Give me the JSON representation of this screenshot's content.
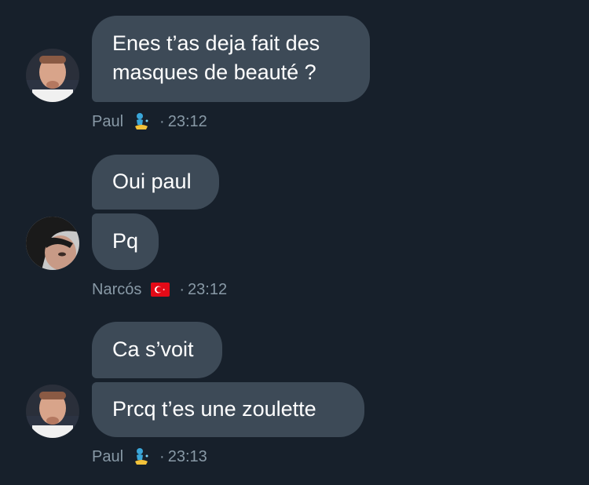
{
  "conversation": [
    {
      "sender": "Paul",
      "badge_icon": "genie-icon",
      "time": "23:12",
      "messages": [
        "Enes t’as deja fait des\nmasques de beauté ?"
      ]
    },
    {
      "sender": "Narcós",
      "badge_icon": "turkey-flag-icon",
      "time": "23:12",
      "messages": [
        "Oui paul",
        "Pq"
      ]
    },
    {
      "sender": "Paul",
      "badge_icon": "genie-icon",
      "time": "23:13",
      "messages": [
        "Ca s’voit",
        "Prcq t’es une zoulette"
      ]
    }
  ],
  "meta_separator": "·",
  "colors": {
    "background": "#17202b",
    "bubble": "#3d4a57",
    "meta_text": "#8899a6"
  }
}
